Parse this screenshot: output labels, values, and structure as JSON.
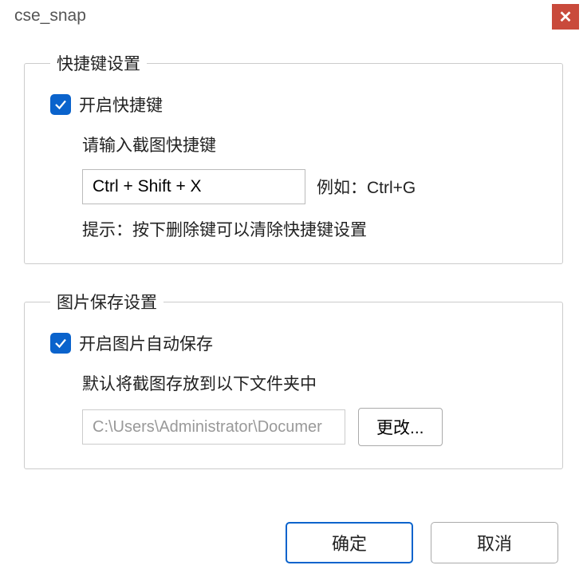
{
  "window": {
    "title": "cse_snap"
  },
  "shortcut_section": {
    "legend": "快捷键设置",
    "enable_label": "开启快捷键",
    "enable_checked": true,
    "instruction": "请输入截图快捷键",
    "shortcut_value": "Ctrl + Shift + X",
    "example": "例如：Ctrl+G",
    "hint": "提示：按下删除键可以清除快捷键设置"
  },
  "save_section": {
    "legend": "图片保存设置",
    "enable_label": "开启图片自动保存",
    "enable_checked": true,
    "instruction": "默认将截图存放到以下文件夹中",
    "path_value": "C:\\Users\\Administrator\\Documer",
    "change_label": "更改..."
  },
  "buttons": {
    "ok": "确定",
    "cancel": "取消"
  }
}
